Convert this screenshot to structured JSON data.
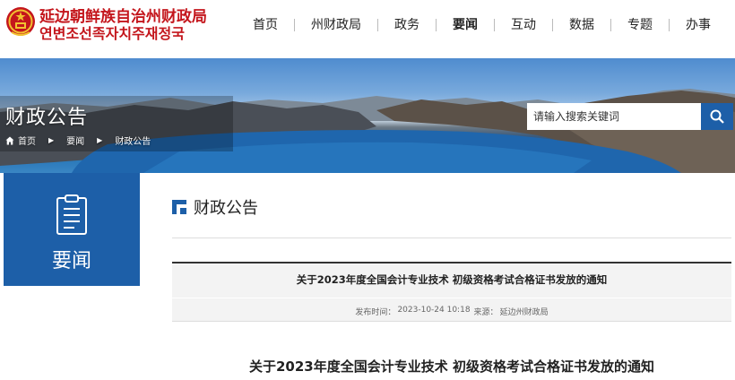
{
  "header": {
    "site_name_cn": "延边朝鲜族自治州财政局",
    "site_name_kr": "연변조선족자치주재정국",
    "logo_icon": "national-emblem-icon"
  },
  "nav": {
    "items": [
      {
        "label": "首页"
      },
      {
        "label": "州财政局"
      },
      {
        "label": "政务"
      },
      {
        "label": "要闻"
      },
      {
        "label": "互动"
      },
      {
        "label": "数据"
      },
      {
        "label": "专题"
      },
      {
        "label": "办事"
      }
    ],
    "active_index": 3
  },
  "banner": {
    "title": "财政公告",
    "breadcrumb": {
      "home_icon": "home-icon",
      "items": [
        "首页",
        "要闻",
        "财政公告"
      ]
    }
  },
  "search": {
    "placeholder": "请输入搜索关键词",
    "button_icon": "search-icon"
  },
  "sidebar": {
    "label": "要闻",
    "icon": "document-list-icon"
  },
  "section": {
    "title": "财政公告"
  },
  "article": {
    "title": "关于2023年度全国会计专业技术 初级资格考试合格证书发放的通知",
    "meta_date_label": "发布时间：",
    "meta_date": "2023-10-24 10:18",
    "meta_source_label": "来源：",
    "meta_source": "延边州财政局",
    "heading": "关于2023年度全国会计专业技术 初级资格考试合格证书发放的通知"
  },
  "colors": {
    "brand_red": "#c4161c",
    "brand_blue": "#1d5fa8"
  }
}
